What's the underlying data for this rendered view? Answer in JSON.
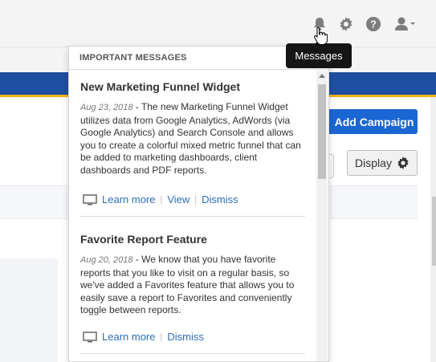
{
  "header": {
    "icons": [
      "bell-icon",
      "gear-icon",
      "help-icon",
      "user-icon"
    ],
    "tooltip": "Messages"
  },
  "toolbar": {
    "add_campaign_label": "Add Campaign",
    "display_label": "Display"
  },
  "popup": {
    "title": "IMPORTANT MESSAGES",
    "messages": [
      {
        "title": "New Marketing Funnel Widget",
        "date": "Aug 23, 2018",
        "body": " - The new Marketing Funnel Widget utilizes data from Google Analytics, AdWords (via Google Analytics) and Search Console and allows you to create a colorful mixed metric funnel that can be added to marketing dashboards, client dashboards and PDF reports.",
        "actions": [
          "Learn more",
          "View",
          "Dismiss"
        ]
      },
      {
        "title": "Favorite Report Feature",
        "date": "Aug 20, 2018",
        "body": " - We know that you have favorite reports that you like to visit on a regular basis, so we've added a Favorites feature that allows you to easily save a report to Favorites and conveniently toggle between reports.",
        "actions": [
          "Learn more",
          "Dismiss"
        ]
      }
    ]
  },
  "colors": {
    "accent_blue": "#1a66d2",
    "stripe_blue": "#1f4fa0",
    "stripe_gold": "#f2b21a",
    "link": "#2a6ebb"
  }
}
